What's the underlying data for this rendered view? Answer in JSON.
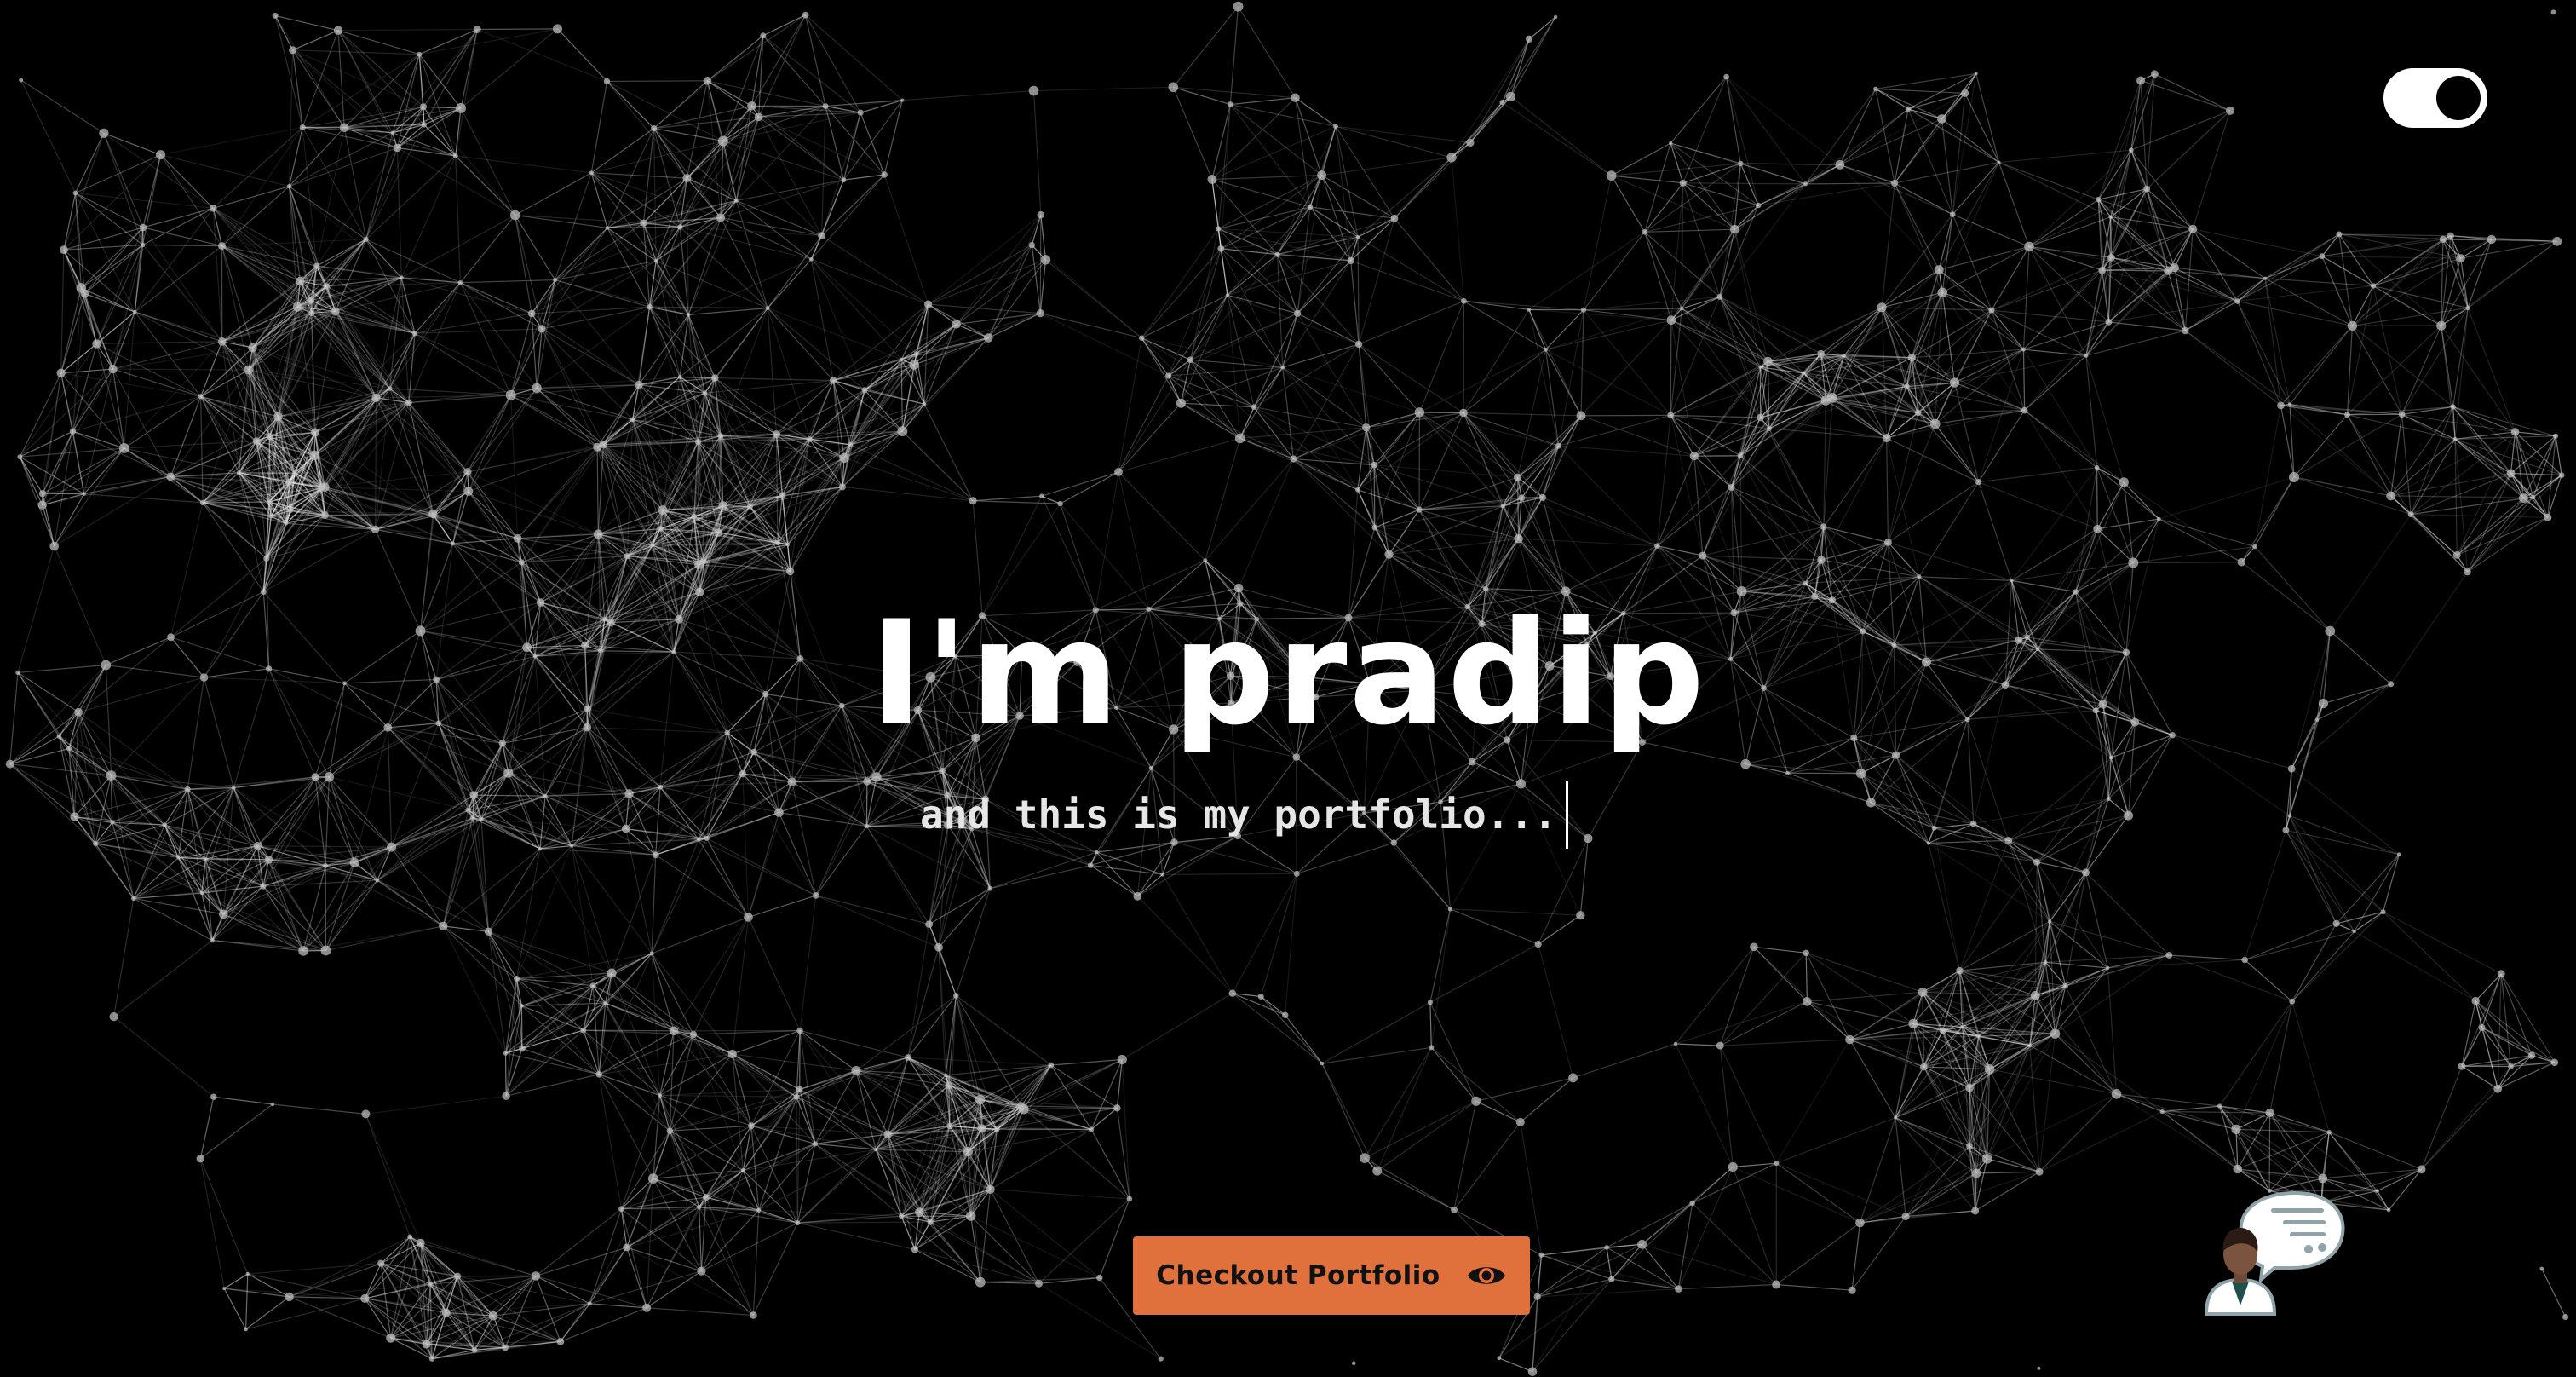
{
  "hero": {
    "title": "I'm pradip",
    "subtitle": "and this is my portfolio..."
  },
  "cta": {
    "label": "Checkout Portfolio",
    "icon": "eye-icon"
  },
  "theme_toggle": {
    "state": "dark",
    "icon": "toggle-switch-icon"
  },
  "chat": {
    "icon": "chatbot-avatar-icon"
  },
  "colors": {
    "background": "#000000",
    "text": "#ffffff",
    "accent": "#e0703c",
    "network_line": "#ffffff"
  }
}
